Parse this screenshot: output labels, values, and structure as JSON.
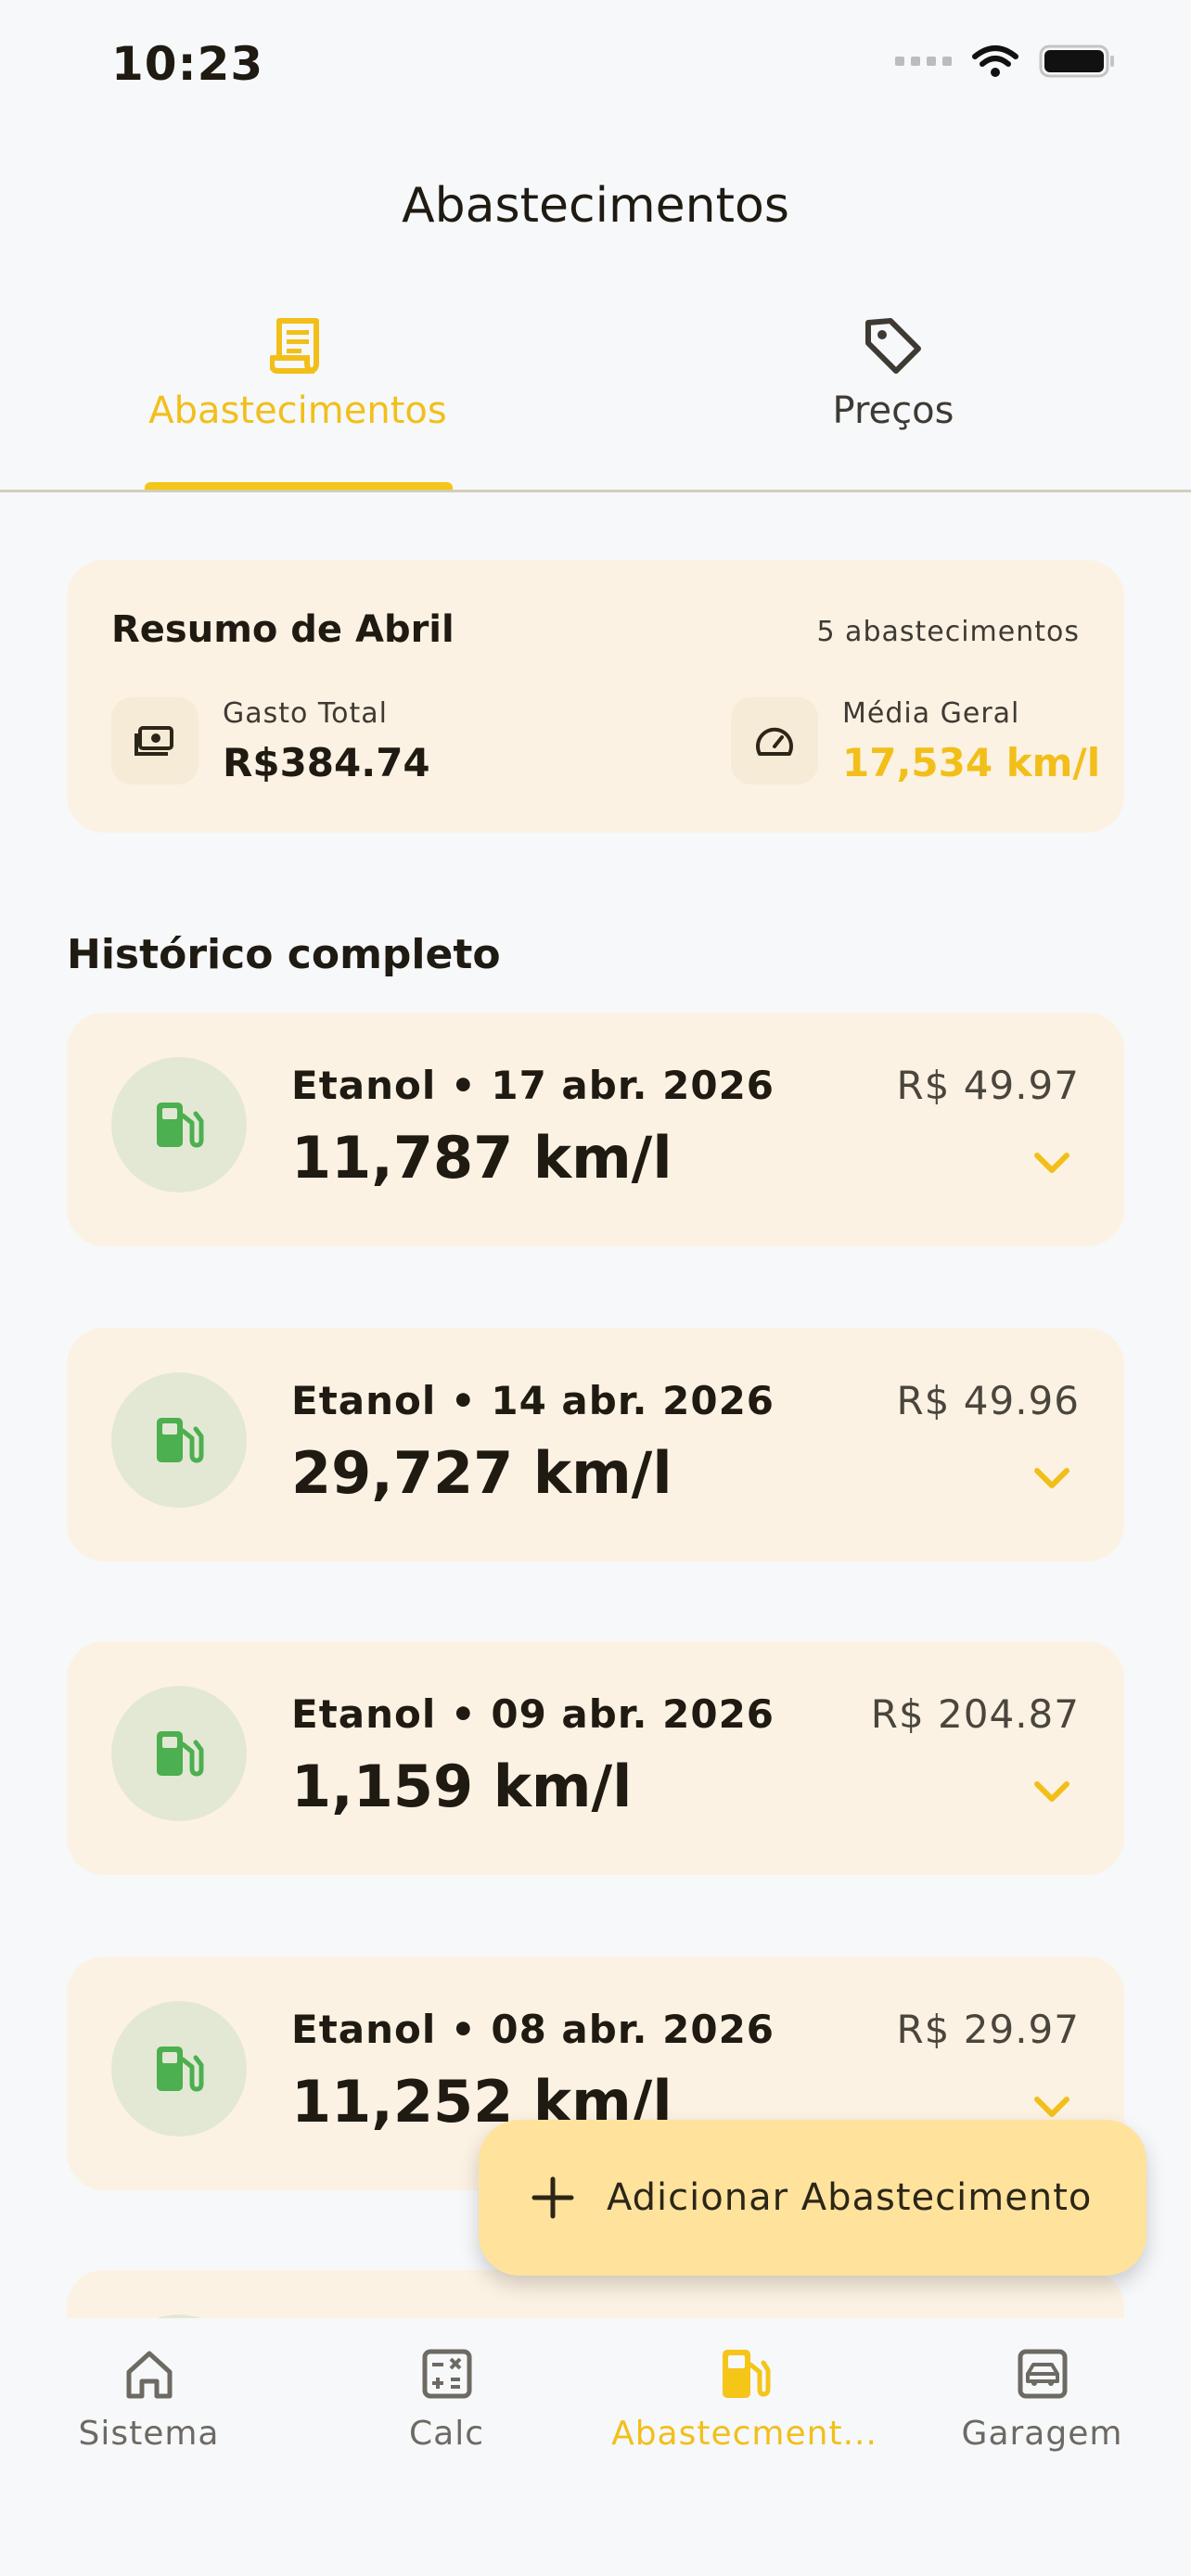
{
  "status_bar": {
    "time": "10:23"
  },
  "page_title": "Abastecimentos",
  "tabs": [
    {
      "label": "Abastecimentos",
      "icon": "receipt-icon",
      "active": true
    },
    {
      "label": "Preços",
      "icon": "tag-icon",
      "active": false
    }
  ],
  "summary": {
    "title": "Resumo de Abril",
    "count": "5 abastecimentos",
    "total_label": "Gasto Total",
    "total_value": "R$384.74",
    "avg_label": "Média Geral",
    "avg_value": "17,534 km/l"
  },
  "history_title": "Histórico completo",
  "entries": [
    {
      "title": "Etanol • 17 abr. 2026",
      "efficiency": "11,787 km/l",
      "price": "R$ 49.97"
    },
    {
      "title": "Etanol • 14 abr. 2026",
      "efficiency": "29,727 km/l",
      "price": "R$ 49.96"
    },
    {
      "title": "Etanol • 09 abr. 2026",
      "efficiency": "1,159 km/l",
      "price": "R$ 204.87"
    },
    {
      "title": "Etanol • 08 abr. 2026",
      "efficiency": "11,252 km/l",
      "price": "R$ 29.97"
    }
  ],
  "fab": {
    "label": "Adicionar Abastecimento"
  },
  "bottom_nav": [
    {
      "label": "Sistema",
      "icon": "home-icon"
    },
    {
      "label": "Calc",
      "icon": "calculator-icon"
    },
    {
      "label": "Abastecment...",
      "icon": "fuel-pump-icon",
      "active": true
    },
    {
      "label": "Garagem",
      "icon": "car-icon"
    }
  ],
  "colors": {
    "accent": "#f5c518",
    "card": "#fcf2e3",
    "fuel_green": "#4caf50",
    "background": "#f6f8fa"
  }
}
